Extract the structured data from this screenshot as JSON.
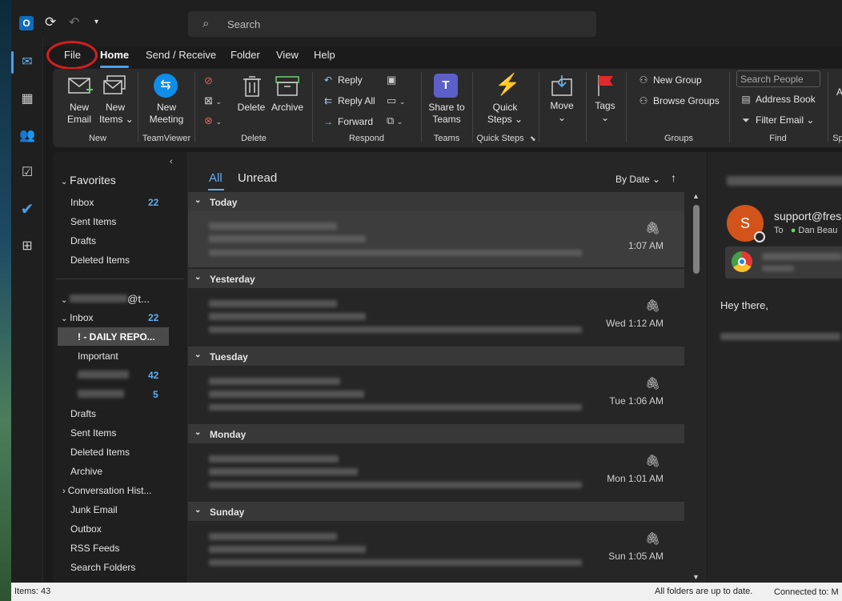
{
  "search": {
    "placeholder": "Search"
  },
  "menu": {
    "tabs": [
      "File",
      "Home",
      "Send / Receive",
      "Folder",
      "View",
      "Help"
    ]
  },
  "ribbon": {
    "new_email": [
      "New",
      "Email"
    ],
    "new_items": [
      "New",
      "Items"
    ],
    "new_meeting": [
      "New",
      "Meeting"
    ],
    "delete": "Delete",
    "archive": "Archive",
    "reply": "Reply",
    "reply_all": "Reply All",
    "forward": "Forward",
    "share_to_teams": [
      "Share to",
      "Teams"
    ],
    "quick_steps": [
      "Quick",
      "Steps"
    ],
    "move": "Move",
    "tags": "Tags",
    "new_group": "New Group",
    "browse_groups": "Browse Groups",
    "search_people": "Search People",
    "address_book": "Address Book",
    "filter_email": "Filter Email",
    "groups_labels": [
      "New",
      "TeamViewer",
      "Delete",
      "Respond",
      "Teams",
      "Quick Steps",
      "Groups",
      "Find",
      "Sp"
    ]
  },
  "folders": {
    "favorites_title": "Favorites",
    "favorites": [
      {
        "label": "Inbox",
        "count": "22"
      },
      {
        "label": "Sent Items",
        "count": ""
      },
      {
        "label": "Drafts",
        "count": ""
      },
      {
        "label": "Deleted Items",
        "count": ""
      }
    ],
    "account_suffix": "@t...",
    "inbox": {
      "label": "Inbox",
      "count": "22"
    },
    "selected_sub": "! - DAILY REPO...",
    "important": "Important",
    "sub_counts": [
      "42",
      "5"
    ],
    "rest": [
      "Drafts",
      "Sent Items",
      "Deleted Items",
      "Archive",
      "Conversation Hist...",
      "Junk Email",
      "Outbox",
      "RSS Feeds",
      "Search Folders"
    ]
  },
  "list": {
    "tab_all": "All",
    "tab_unread": "Unread",
    "sort": "By Date",
    "groups": [
      {
        "header": "Today",
        "time": "1:07 AM"
      },
      {
        "header": "Yesterday",
        "time": "Wed 1:12 AM"
      },
      {
        "header": "Tuesday",
        "time": "Tue 1:06 AM"
      },
      {
        "header": "Monday",
        "time": "Mon 1:01 AM"
      },
      {
        "header": "Sunday",
        "time": "Sun 1:05 AM"
      }
    ]
  },
  "reading": {
    "avatar_letter": "S",
    "sender": "support@fres",
    "to_label": "To",
    "recipient": "Dan Beau",
    "greeting": "Hey there,"
  },
  "status": {
    "items": "Items: 43",
    "sync": "All folders are up to date.",
    "connected": "Connected to: M"
  },
  "colors": {
    "accent": "#4ca0e8",
    "count": "#61aef0",
    "avatar": "#d2541a",
    "flag": "#e02a2a"
  }
}
